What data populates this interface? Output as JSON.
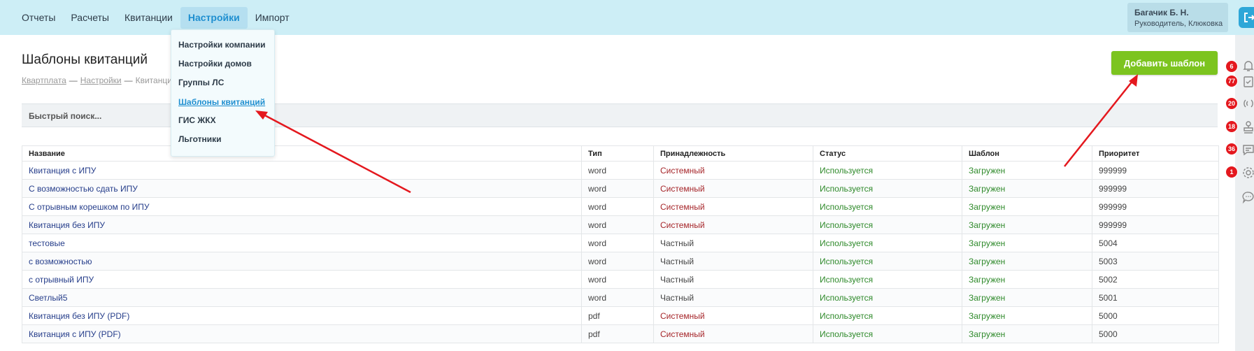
{
  "nav": {
    "items": [
      {
        "label": "Отчеты",
        "active": false
      },
      {
        "label": "Расчеты",
        "active": false
      },
      {
        "label": "Квитанции",
        "active": false
      },
      {
        "label": "Настройки",
        "active": true
      },
      {
        "label": "Импорт",
        "active": false
      }
    ]
  },
  "user": {
    "name": "Багачик Б. Н.",
    "role": "Руководитель, Клюковка"
  },
  "settings_menu": {
    "items": [
      {
        "label": "Настройки компании",
        "active": false
      },
      {
        "label": "Настройки домов",
        "active": false
      },
      {
        "label": "Группы ЛС",
        "active": false
      },
      {
        "label": "Шаблоны квитанций",
        "active": true
      },
      {
        "label": "ГИС ЖКХ",
        "active": false
      },
      {
        "label": "Льготники",
        "active": false
      }
    ]
  },
  "page": {
    "title": "Шаблоны квитанций",
    "breadcrumb": [
      "Квартплата",
      "Настройки",
      "Квитанци"
    ],
    "breadcrumb_sep": "—",
    "add_button": "Добавить шаблон"
  },
  "search": {
    "placeholder": "Быстрый поиск..."
  },
  "rail": {
    "items": [
      {
        "badge": "6",
        "icon": "bell-icon"
      },
      {
        "badge": "77",
        "icon": "clipboard-check-icon"
      },
      {
        "badge": "20",
        "icon": "signal-waves-icon"
      },
      {
        "badge": "18",
        "icon": "stamp-icon"
      },
      {
        "badge": "36",
        "icon": "message-icon"
      },
      {
        "badge": "1",
        "icon": "gear-icon"
      },
      {
        "badge": "",
        "icon": "chat-bubble-icon"
      }
    ]
  },
  "table": {
    "columns": [
      "Название",
      "Тип",
      "Принадлежность",
      "Статус",
      "Шаблон",
      "Приоритет"
    ],
    "rows": [
      {
        "name": "Квитанция с ИПУ",
        "type": "word",
        "owner": "Системный",
        "status": "Используется",
        "template": "Загружен",
        "priority": "999999"
      },
      {
        "name": "С возможностью сдать ИПУ",
        "type": "word",
        "owner": "Системный",
        "status": "Используется",
        "template": "Загружен",
        "priority": "999999"
      },
      {
        "name": "С отрывным корешком по ИПУ",
        "type": "word",
        "owner": "Системный",
        "status": "Используется",
        "template": "Загружен",
        "priority": "999999"
      },
      {
        "name": "Квитанция без ИПУ",
        "type": "word",
        "owner": "Системный",
        "status": "Используется",
        "template": "Загружен",
        "priority": "999999"
      },
      {
        "name": "тестовые",
        "type": "word",
        "owner": "Частный",
        "status": "Используется",
        "template": "Загружен",
        "priority": "5004"
      },
      {
        "name": "с возможностью",
        "type": "word",
        "owner": "Частный",
        "status": "Используется",
        "template": "Загружен",
        "priority": "5003"
      },
      {
        "name": "с отрывный ИПУ",
        "type": "word",
        "owner": "Частный",
        "status": "Используется",
        "template": "Загружен",
        "priority": "5002"
      },
      {
        "name": "Светлый5",
        "type": "word",
        "owner": "Частный",
        "status": "Используется",
        "template": "Загружен",
        "priority": "5001"
      },
      {
        "name": "Квитанция без ИПУ (PDF)",
        "type": "pdf",
        "owner": "Системный",
        "status": "Используется",
        "template": "Загружен",
        "priority": "5000"
      },
      {
        "name": "Квитанция с ИПУ (PDF)",
        "type": "pdf",
        "owner": "Системный",
        "status": "Используется",
        "template": "Загружен",
        "priority": "5000"
      }
    ]
  },
  "colors": {
    "accent": "#1f8fd0",
    "topbar": "#cdeef6",
    "add_button": "#7cc41f",
    "arrow": "#e4181e",
    "badge": "#e4181e"
  }
}
